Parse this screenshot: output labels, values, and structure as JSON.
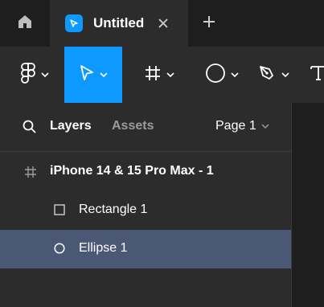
{
  "tabs": {
    "home_icon": "home-icon",
    "active_tab": {
      "title": "Untitled",
      "icon": "figma-file-icon",
      "close_icon": "close-icon"
    },
    "new_tab_icon": "plus-icon"
  },
  "toolbar": {
    "tools": [
      {
        "name": "main-menu",
        "icon": "figma-logo-icon",
        "active": false
      },
      {
        "name": "move-tool",
        "icon": "cursor-icon",
        "active": true
      },
      {
        "name": "frame-tool",
        "icon": "frame-hash-icon",
        "active": false
      },
      {
        "name": "shape-tool",
        "icon": "ellipse-icon",
        "active": false
      },
      {
        "name": "pen-tool",
        "icon": "pen-icon",
        "active": false
      },
      {
        "name": "text-tool",
        "icon": "text-icon",
        "active": false
      }
    ],
    "accent_color": "#0d99ff"
  },
  "panel": {
    "tabs": [
      "Layers",
      "Assets"
    ],
    "page": "Page 1",
    "layers": [
      {
        "name": "iPhone 14 & 15 Pro Max - 1",
        "type": "frame",
        "selected": false
      },
      {
        "name": "Rectangle 1",
        "type": "rectangle",
        "selected": false
      },
      {
        "name": "Ellipse 1",
        "type": "ellipse",
        "selected": true
      }
    ],
    "selection_color": "#4a5876"
  }
}
